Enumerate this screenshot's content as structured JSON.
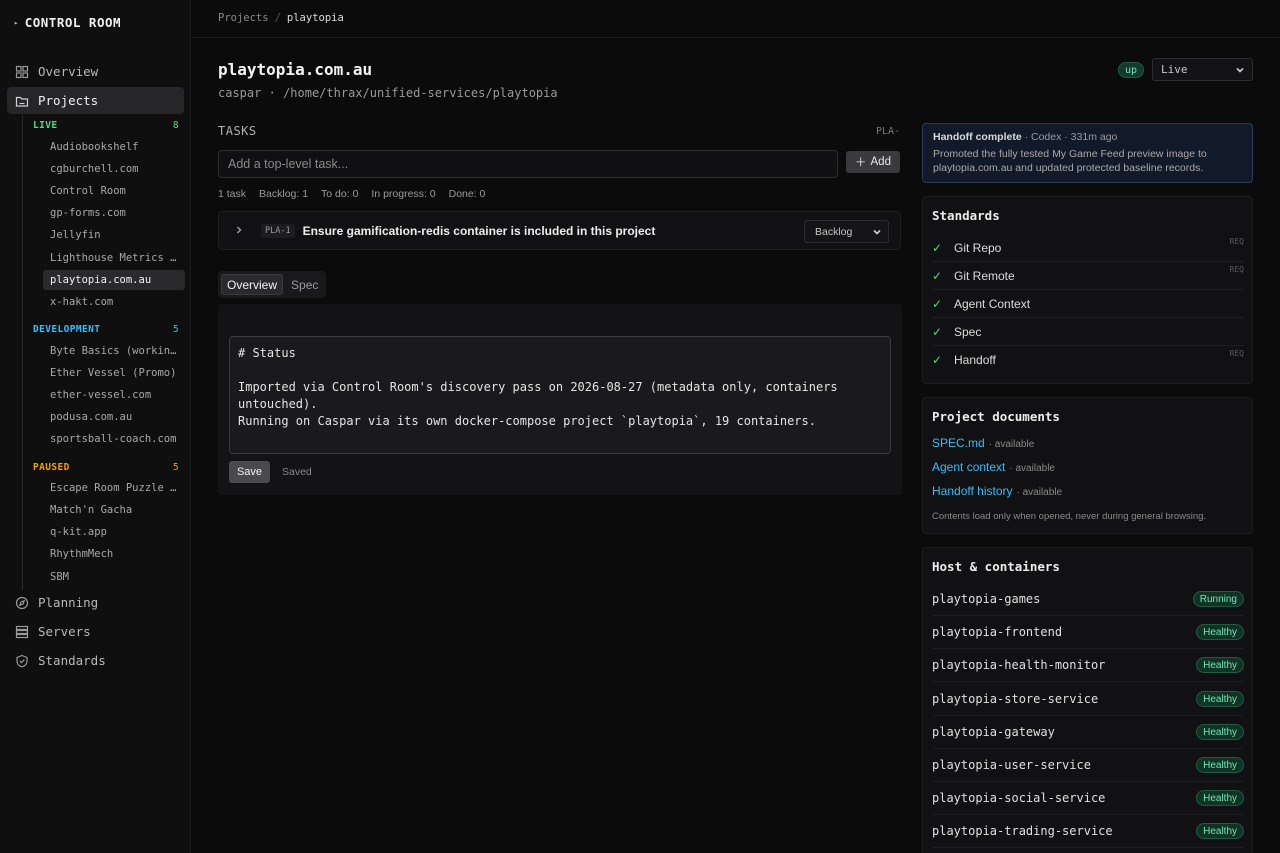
{
  "sidebar": {
    "brand": "CONTROL ROOM",
    "nav": {
      "overview": "Overview",
      "projects": "Projects",
      "planning": "Planning",
      "servers": "Servers",
      "standards": "Standards"
    },
    "groups": {
      "live": {
        "label": "LIVE",
        "count": "8",
        "items": [
          "Audiobookshelf",
          "cgburchell.com",
          "Control Room",
          "gp-forms.com",
          "Jellyfin",
          "Lighthouse Metrics …",
          "playtopia.com.au",
          "x-hakt.com"
        ]
      },
      "development": {
        "label": "DEVELOPMENT",
        "count": "5",
        "items": [
          "Byte Basics (workin…",
          "Ether Vessel (Promo)",
          "ether-vessel.com",
          "podusa.com.au",
          "sportsball-coach.com"
        ]
      },
      "paused": {
        "label": "PAUSED",
        "count": "5",
        "items": [
          "Escape Room Puzzle …",
          "Match'n Gacha",
          "q-kit.app",
          "RhythmMech",
          "SBM"
        ]
      }
    }
  },
  "breadcrumb": {
    "root": "Projects",
    "sep": "/",
    "current": "playtopia"
  },
  "project": {
    "title": "playtopia.com.au",
    "host": "caspar",
    "dot": "·",
    "path": "/home/thrax/unified-services/playtopia",
    "status_badge": "up",
    "env_select": "Live"
  },
  "tasks": {
    "heading": "TASKS",
    "prefix": "PLA-",
    "input_placeholder": "Add a top-level task...",
    "add_label": "Add",
    "counts": [
      "1 task",
      "Backlog: 1",
      "To do: 0",
      "In progress: 0",
      "Done: 0"
    ],
    "items": [
      {
        "id": "PLA-1",
        "title": "Ensure gamification-redis container is included in this project",
        "status": "Backlog"
      }
    ]
  },
  "tabs": {
    "overview": "Overview",
    "spec": "Spec"
  },
  "editor": {
    "line1": "# Status",
    "line2": "Imported via Control Room's discovery pass on 2026-08-27 (metadata only, containers untouched).",
    "line3": "Running on Caspar via its own docker-compose project `playtopia`, 19 containers.",
    "save_label": "Save",
    "saved_label": "Saved"
  },
  "handoff": {
    "title": "Handoff complete",
    "meta": " · Codex · 331m ago",
    "body": "Promoted the fully tested My Game Feed preview image to playtopia.com.au and updated protected baseline records."
  },
  "standards": {
    "heading": "Standards",
    "items": [
      {
        "label": "Git Repo",
        "req": "REQ"
      },
      {
        "label": "Git Remote",
        "req": "REQ"
      },
      {
        "label": "Agent Context",
        "req": ""
      },
      {
        "label": "Spec",
        "req": ""
      },
      {
        "label": "Handoff",
        "req": "REQ"
      }
    ]
  },
  "documents": {
    "heading": "Project documents",
    "items": [
      {
        "label": "SPEC.md",
        "state": "· available"
      },
      {
        "label": "Agent context",
        "state": "· available"
      },
      {
        "label": "Handoff history",
        "state": "· available"
      }
    ],
    "note": "Contents load only when opened, never during general browsing."
  },
  "containers": {
    "heading": "Host & containers",
    "items": [
      {
        "name": "playtopia-games",
        "state": "Running"
      },
      {
        "name": "playtopia-frontend",
        "state": "Healthy"
      },
      {
        "name": "playtopia-health-monitor",
        "state": "Healthy"
      },
      {
        "name": "playtopia-store-service",
        "state": "Healthy"
      },
      {
        "name": "playtopia-gateway",
        "state": "Healthy"
      },
      {
        "name": "playtopia-user-service",
        "state": "Healthy"
      },
      {
        "name": "playtopia-social-service",
        "state": "Healthy"
      },
      {
        "name": "playtopia-trading-service",
        "state": "Healthy"
      }
    ]
  }
}
